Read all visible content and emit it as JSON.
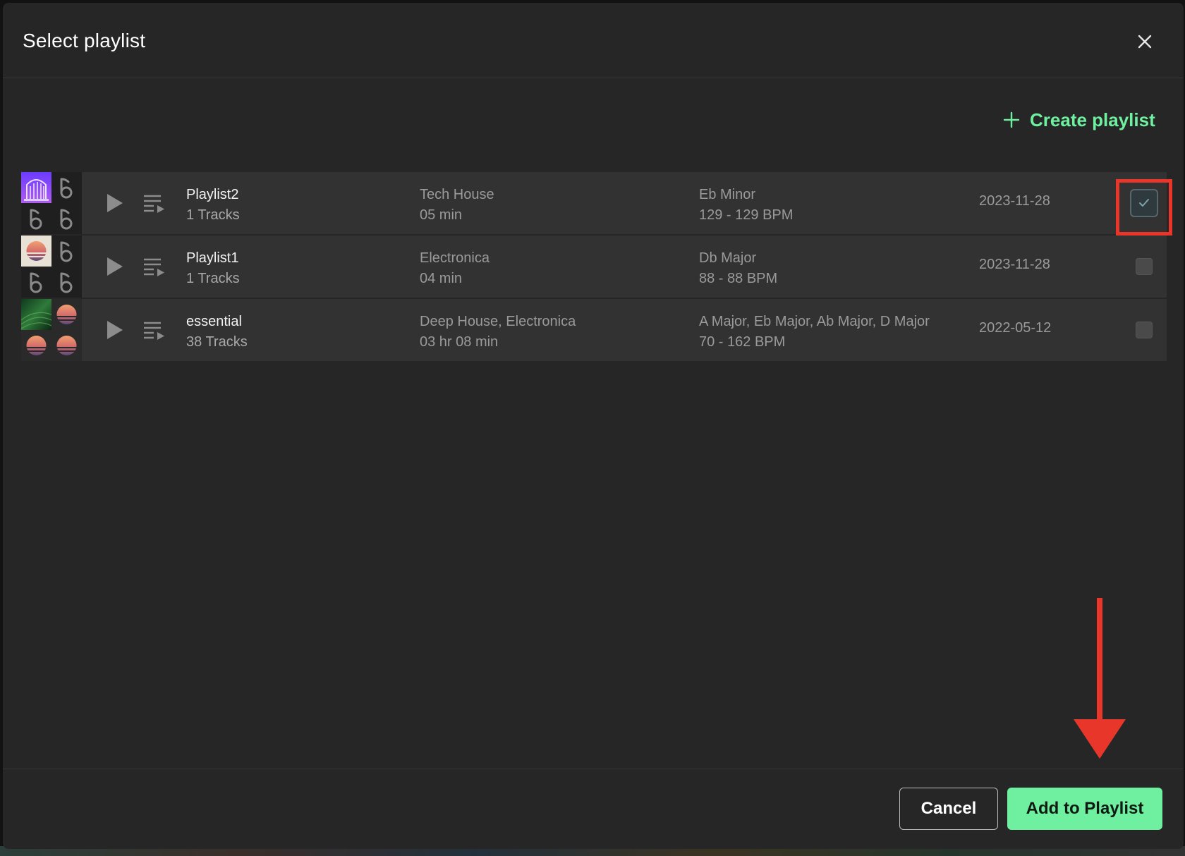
{
  "dialog": {
    "title": "Select playlist",
    "create_label": "Create playlist",
    "cancel_label": "Cancel",
    "confirm_label": "Add to Playlist"
  },
  "playlists": [
    {
      "name": "Playlist2",
      "tracks": "1 Tracks",
      "genre": "Tech House",
      "duration": "05 min",
      "key": "Eb Minor",
      "bpm": "129 - 129 BPM",
      "date": "2023-11-28",
      "checked": true
    },
    {
      "name": "Playlist1",
      "tracks": "1 Tracks",
      "genre": "Electronica",
      "duration": "04 min",
      "key": "Db Major",
      "bpm": "88 - 88 BPM",
      "date": "2023-11-28",
      "checked": false
    },
    {
      "name": "essential",
      "tracks": "38 Tracks",
      "genre": "Deep House, Electronica",
      "duration": "03 hr 08 min",
      "key": "A Major, Eb Major, Ab Major, D Major",
      "bpm": "70 - 162 BPM",
      "date": "2022-05-12",
      "checked": false
    }
  ],
  "icons": {
    "close": "close-icon",
    "plus": "plus-icon",
    "play": "play-icon",
    "queue": "queue-icon",
    "music_note": "music-note-icon",
    "check": "check-icon"
  },
  "colors": {
    "accent": "#6ff0a0",
    "panel": "#262626",
    "row": "#323232",
    "annotation": "#e8362a"
  }
}
